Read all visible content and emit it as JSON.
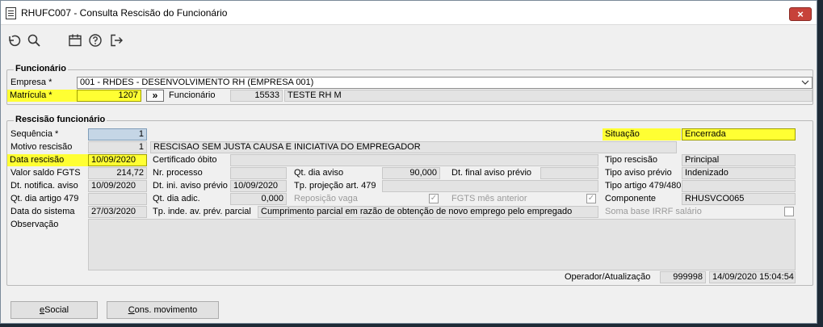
{
  "window": {
    "title": "RHUFC007 - Consulta Rescisão do Funcionário",
    "close_glyph": "×"
  },
  "funcionario_group": {
    "title": "Funcionário",
    "empresa_label": "Empresa *",
    "empresa_value": "001 - RHDES - DESENVOLVIMENTO RH (EMPRESA 001)",
    "matricula_label": "Matrícula *",
    "matricula_value": "1207",
    "lookup_glyph": "»",
    "funcionario_label": "Funcionário",
    "funcionario_code": "15533",
    "funcionario_name": "TESTE RH M"
  },
  "rescisao_group": {
    "title": "Rescisão funcionário",
    "sequencia_label": "Sequência *",
    "sequencia_value": "1",
    "motivo_label": "Motivo rescisão",
    "motivo_code": "1",
    "motivo_desc": "RESCISAO SEM JUSTA CAUSA E INICIATIVA DO EMPREGADOR",
    "data_rescisao_label": "Data rescisão",
    "data_rescisao_value": "10/09/2020",
    "valor_fgts_label": "Valor saldo FGTS",
    "valor_fgts_value": "214,72",
    "dt_notifica_label": "Dt. notifica. aviso",
    "dt_notifica_value": "10/09/2020",
    "qt_artigo_label": "Qt. dia artigo 479",
    "qt_artigo_value": "",
    "data_sistema_label": "Data do sistema",
    "data_sistema_value": "27/03/2020",
    "observacao_label": "Observação",
    "observacao_value": "",
    "certificado_label": "Certificado óbito",
    "certificado_value": "",
    "nr_processo_label": "Nr. processo",
    "nr_processo_value": "",
    "dt_ini_aviso_label": "Dt. ini. aviso prévio",
    "dt_ini_aviso_value": "10/09/2020",
    "qt_dia_adic_label": "Qt. dia adic.",
    "qt_dia_adic_value": "0,000",
    "tp_inde_label": "Tp. inde. av. prév. parcial",
    "tp_inde_value": "Cumprimento parcial em razão de obtenção de novo emprego pelo empregado",
    "qt_dia_aviso_label": "Qt. dia aviso",
    "qt_dia_aviso_value": "90,000",
    "tp_projecao_label": "Tp. projeção art. 479",
    "tp_projecao_value": "",
    "reposicao_label": "Reposição vaga",
    "dt_final_label": "Dt. final aviso prévio",
    "dt_final_value": "",
    "fgts_mes_label": "FGTS mês anterior",
    "situacao_label": "Situação",
    "situacao_value": "Encerrada",
    "tipo_rescisao_label": "Tipo rescisão",
    "tipo_rescisao_value": "Principal",
    "tipo_aviso_label": "Tipo aviso prévio",
    "tipo_aviso_value": "Indenizado",
    "tipo_artigo_label": "Tipo artigo 479/480",
    "tipo_artigo_value": "",
    "componente_label": "Componente",
    "componente_value": "RHUSVCO065",
    "soma_base_label": "Soma base IRRF salário",
    "operador_label": "Operador/Atualização",
    "operador_code": "999998",
    "operador_datetime": "14/09/2020 15:04:54"
  },
  "buttons": {
    "esocial": "eSocial",
    "cons_movimento": "Cons. movimento"
  },
  "icons": {
    "undo": "undo-icon",
    "search": "search-icon",
    "calendar": "calendar-icon",
    "help": "help-icon",
    "exit": "exit-icon",
    "dropdown": "chevron-down-icon",
    "check": "✓"
  },
  "colors": {
    "highlight": "#ffff33",
    "close": "#c7423a"
  }
}
